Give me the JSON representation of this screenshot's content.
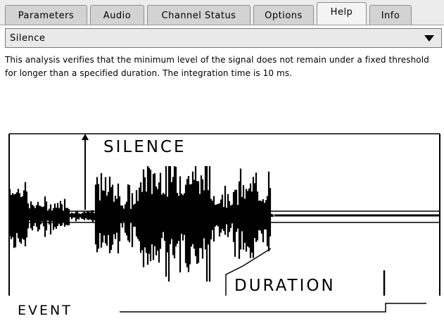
{
  "tabs": [
    {
      "label": "Parameters"
    },
    {
      "label": "Audio"
    },
    {
      "label": "Channel Status"
    },
    {
      "label": "Options"
    },
    {
      "label": "Help",
      "active": true
    },
    {
      "label": "Info"
    }
  ],
  "analysis_select": {
    "value": "Silence",
    "icon": "chevron-down-icon"
  },
  "help": {
    "description": "This analysis verifies that the minimum level of the signal does not remain under a fixed threshold for longer than a specified duration. The integration time is 10 ms."
  },
  "diagram": {
    "silence_label": "SILENCE",
    "duration_label": "DURATION",
    "event_label": "EVENT"
  },
  "colors": {
    "tab_bg": "#d3d3d3",
    "tab_active_bg": "#f4f4f4",
    "dropdown_bg": "#e9e9e9",
    "waveform": "#000000"
  }
}
